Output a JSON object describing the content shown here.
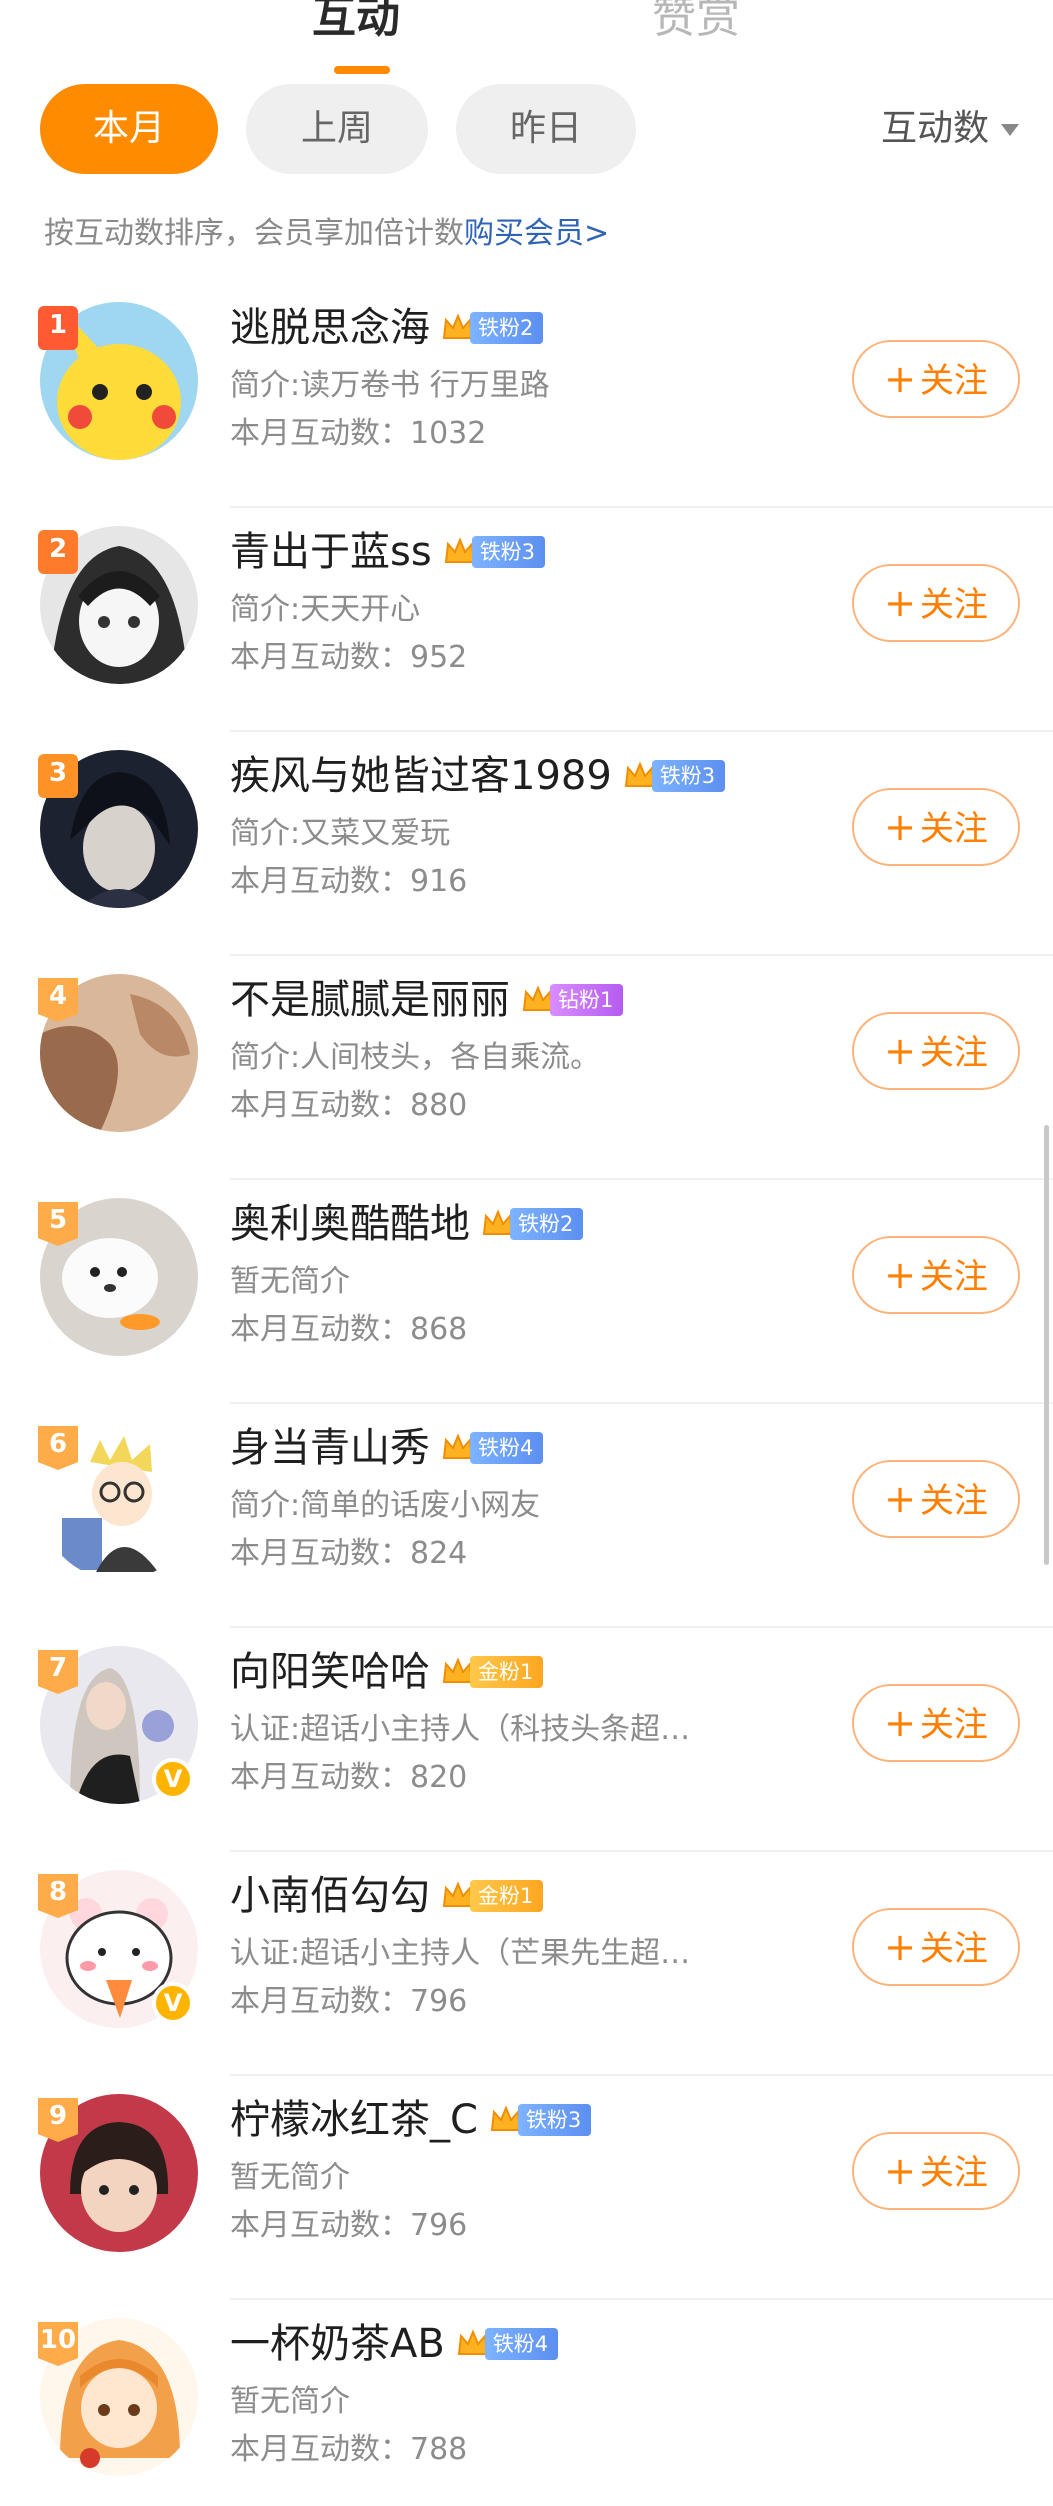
{
  "top_tabs": {
    "active": "互动",
    "inactive": "赞赏"
  },
  "filters": {
    "pill1": "本月",
    "pill2": "上周",
    "pill3": "昨日",
    "sort": "互动数"
  },
  "hint": {
    "text": "按互动数排序，会员享加倍计数",
    "link": "购买会员>"
  },
  "follow_label": "关注",
  "colors": {
    "accent": "#ff8c00",
    "link": "#2f63b6"
  },
  "users": [
    {
      "rank": "1",
      "name": "逃脱思念海",
      "fan_level": "铁粉2",
      "bio": "简介:读万卷书 行万里路",
      "count": "本月互动数：1032"
    },
    {
      "rank": "2",
      "name": "青出于蓝ss",
      "fan_level": "铁粉3",
      "bio": "简介:天天开心",
      "count": "本月互动数：952"
    },
    {
      "rank": "3",
      "name": "疾风与她皆过客1989",
      "fan_level": "铁粉3",
      "bio": "简介:又菜又爱玩",
      "count": "本月互动数：916"
    },
    {
      "rank": "4",
      "name": "不是腻腻是丽丽",
      "fan_level": "钻粉1",
      "bio": "简介:人间枝头，各自乘流。",
      "count": "本月互动数：880"
    },
    {
      "rank": "5",
      "name": "奥利奥酷酷地",
      "fan_level": "铁粉2",
      "bio": "暂无简介",
      "count": "本月互动数：868"
    },
    {
      "rank": "6",
      "name": "身当青山秀",
      "fan_level": "铁粉4",
      "bio": "简介:简单的话废小网友",
      "count": "本月互动数：824"
    },
    {
      "rank": "7",
      "name": "向阳笑哈哈",
      "fan_level": "金粉1",
      "bio": "认证:超话小主持人（科技头条超…",
      "count": "本月互动数：820"
    },
    {
      "rank": "8",
      "name": "小南佰勾勾",
      "fan_level": "金粉1",
      "bio": "认证:超话小主持人（芒果先生超…",
      "count": "本月互动数：796"
    },
    {
      "rank": "9",
      "name": "柠檬冰红茶_C",
      "fan_level": "铁粉3",
      "bio": "暂无简介",
      "count": "本月互动数：796"
    },
    {
      "rank": "10",
      "name": "一杯奶茶AB",
      "fan_level": "铁粉4",
      "bio": "暂无简介",
      "count": "本月互动数：788"
    }
  ]
}
